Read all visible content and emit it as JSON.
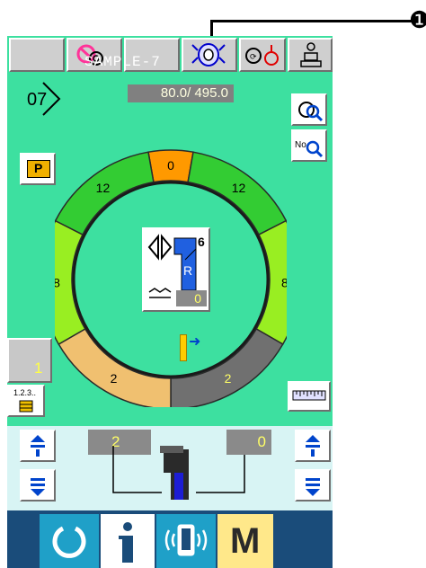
{
  "callout": {
    "number": "❶"
  },
  "header": {
    "program_name": "SAMPLE-7",
    "stitch_counter": "80.0/ 495.0"
  },
  "program_number": "07",
  "buttons": {
    "p_label": "P",
    "step_value": "1",
    "step_icon_text": "1.2.3.."
  },
  "center": {
    "pattern_number": "6",
    "pattern_letter": "R",
    "stitch_count": "0"
  },
  "segments": [
    {
      "position": "top",
      "label": "0",
      "color": "#ff9900"
    },
    {
      "position": "top-right",
      "label": "12",
      "color": "#33cc33"
    },
    {
      "position": "right",
      "label": "8",
      "color": "#99ee22"
    },
    {
      "position": "bottom-right",
      "label": "2",
      "color": "#707070"
    },
    {
      "position": "bottom-left",
      "label": "2",
      "color": "#f0c070"
    },
    {
      "position": "left",
      "label": "8",
      "color": "#99ee22"
    },
    {
      "position": "top-left",
      "label": "12",
      "color": "#33cc33"
    }
  ],
  "bottom": {
    "left_value": "2",
    "right_value": "0"
  },
  "nav": {
    "menu_label": "M"
  },
  "colors": {
    "panel": "#3de0a0",
    "lower_panel": "#d8f4f4",
    "nav_bg": "#1a4c7a",
    "accent": "#0000cc"
  }
}
